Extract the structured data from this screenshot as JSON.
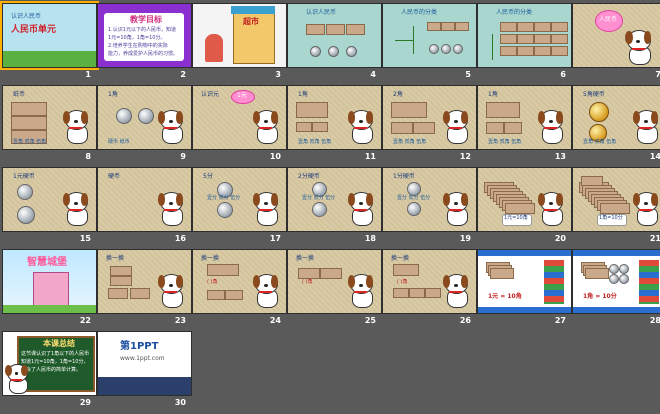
{
  "slides": [
    {
      "num": "1",
      "title": "人民币单元",
      "sub": "认识人民币"
    },
    {
      "num": "2",
      "title": "教学目标",
      "lines": [
        "1.认识1元以下的人民币，知道",
        "1元=10角，1角=10分。",
        "2.培养学生在购物中的实际",
        "能力，养成爱护人民币的习惯。"
      ]
    },
    {
      "num": "3",
      "title": "超市"
    },
    {
      "num": "4",
      "title": "认识人民币"
    },
    {
      "num": "5",
      "title": "人民币的分类"
    },
    {
      "num": "6",
      "title": "人民币的分类"
    },
    {
      "num": "7",
      "title": "",
      "bubble": "人民币"
    },
    {
      "num": "8",
      "title": "纸币",
      "caption": "壹角  贰角  伍角"
    },
    {
      "num": "9",
      "title": "1角",
      "caption": "硬币  纸币"
    },
    {
      "num": "10",
      "title": "认识元",
      "bubble": "1元"
    },
    {
      "num": "11",
      "title": "1角",
      "caption": "壹角  贰角  伍角"
    },
    {
      "num": "12",
      "title": "2角",
      "caption": "壹角  贰角  伍角"
    },
    {
      "num": "13",
      "title": "1角",
      "caption": "壹角  贰角  伍角"
    },
    {
      "num": "14",
      "title": "5角硬币",
      "caption": "壹角  贰角  伍角"
    },
    {
      "num": "15",
      "title": "1元硬币"
    },
    {
      "num": "16",
      "title": "硬币"
    },
    {
      "num": "17",
      "title": "5分",
      "caption": "壹分  贰分  伍分"
    },
    {
      "num": "18",
      "title": "2分硬币",
      "caption": "壹分  贰分  伍分"
    },
    {
      "num": "19",
      "title": "1分硬币",
      "caption": "壹分  贰分  伍分"
    },
    {
      "num": "20",
      "title": "",
      "box": "1元=10角"
    },
    {
      "num": "21",
      "title": "",
      "box": "1角=10分"
    },
    {
      "num": "22",
      "title": "智慧城堡"
    },
    {
      "num": "23",
      "title": "换一换"
    },
    {
      "num": "24",
      "title": "换一换",
      "caption": "(  )角"
    },
    {
      "num": "25",
      "title": "换一换",
      "caption": "(  )角"
    },
    {
      "num": "26",
      "title": "换一换",
      "caption": "(  )角"
    },
    {
      "num": "27",
      "title": "",
      "eq": "1元 = 10角"
    },
    {
      "num": "28",
      "title": "",
      "eq": "1角 = 10分"
    },
    {
      "num": "29",
      "title": "本课总结",
      "lines": [
        "这节课认识了1角以下的人民币",
        "知道1元=10角，1角=10分，",
        "学会了人民币的简单计算。"
      ]
    },
    {
      "num": "30",
      "title": "第1PPT",
      "sub": "www.1ppt.com"
    }
  ]
}
